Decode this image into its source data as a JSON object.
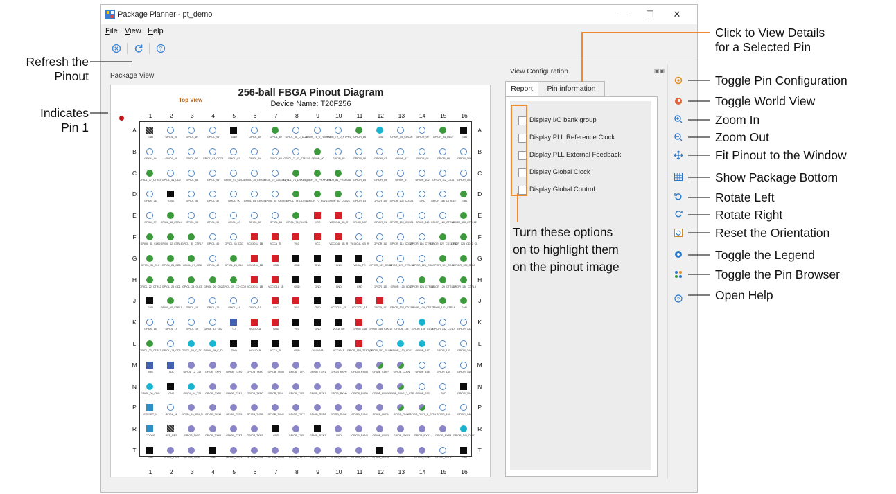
{
  "window": {
    "title": "Package Planner - pt_demo",
    "controls": [
      "—",
      "☐",
      "✕"
    ]
  },
  "menu": [
    {
      "key": "F",
      "rest": "ile"
    },
    {
      "key": "V",
      "rest": "iew"
    },
    {
      "key": "H",
      "rest": "elp"
    }
  ],
  "package_view": {
    "label": "Package View",
    "title": "256-ball FBGA Pinout Diagram",
    "device": "Device Name: T20F256",
    "top_view": "Top View"
  },
  "pinout": {
    "columns": [
      "1",
      "2",
      "3",
      "4",
      "5",
      "6",
      "7",
      "8",
      "9",
      "10",
      "11",
      "12",
      "13",
      "14",
      "15",
      "16"
    ],
    "rows": [
      "A",
      "B",
      "C",
      "D",
      "E",
      "F",
      "G",
      "H",
      "J",
      "K",
      "L",
      "M",
      "N",
      "P",
      "R",
      "T"
    ],
    "legend_colors": {
      "o": "#4a84c4",
      "g": "#3c9a3c",
      "k": "#0d0d0d",
      "r": "#d62027",
      "c": "#19b5d0",
      "p": "#8a85c7",
      "b": "#4361b0",
      "s": "#2e8fc7",
      "x": "#555555",
      "m": "#7ba05b"
    },
    "codes": [
      "xoooko gooogcoogk",
      "oooooooogoooooooo",
      "goooooogggoooooog",
      "okooooogggooooogk",
      "ogooooogrrooooogg",
      "gggoorrrrrooooggg",
      "gggogrrkkkkoooggg",
      "gggggrrkkkkoogggg",
      "kgoooorrkkrrooggk",
      "oooobrrkkkroocooo",
      "gocckkkkkkroccoo",
      "bbpppppppppmmooo",
      "ckcpppppppppmook",
      "soppppppppppmmoo",
      "sxppppkpkppppppc",
      "kppkpppppppkppok"
    ],
    "names": [
      [
        "GND",
        "GPIOL_90",
        "GPIOL_87",
        "GPIOL_96",
        "GND",
        "GPIOL_69",
        "GPIOL_62",
        "GPIOL_66_C_DC12",
        "GPIOR_78_D_RTPRD_CD13",
        "GPIOR_79_D_RTPRD_CD13_0",
        "GPIOR_86",
        "GND",
        "GPIOR_89_CDC26",
        "GPIOR_99",
        "GPIOR_94_DD27",
        "GND"
      ],
      [
        "GPIOL_44",
        "GPIOL_48",
        "GPIOL_92",
        "GPIOL_93_CDC5",
        "GPIOL_63",
        "GPIOL_64",
        "GPIOL_60",
        "GPIOL_71_G_STATUS",
        "GPIOR_80",
        "GPIOR_82",
        "GPIOR_88",
        "GPIOR_93",
        "GPIOR_97",
        "GPIOR_92",
        "GPIOR_98",
        "GPIOR_106"
      ],
      [
        "GPIOL_37_CTRL5",
        "GPIOL_41_CD3",
        "GPIOL_68",
        "GPIOL_95",
        "GPIOL_67_CDC3",
        "GPIOL_70_CRXEG",
        "GPIOL_72_CRXEG_CD23",
        "GPIOL_73_DRXEG_CD23",
        "GPIOR_76_PRXPD18",
        "GPIOR_81_PRXPD18",
        "GPIOR_85",
        "GPIOR_89",
        "GPIOR_91",
        "GPIOR_102",
        "GPIOR_112_CD21",
        "GPIOR_103"
      ],
      [
        "GPIOL_36",
        "GND",
        "GPIOL_46",
        "GPIOL_47",
        "GPIOL_90",
        "GPIOL_65_CRXEG",
        "GPIOL_65_CRXEG",
        "GPIOL_74_DLVS1",
        "GPIOR_77_PLVS1",
        "GPIOR_87_CCD21",
        "GPIOR_83",
        "GPIOR_100",
        "GPIOR_104_CD126",
        "GND",
        "GPIOR_116_CTRL19",
        "GND"
      ],
      [
        "GPIOL_37",
        "GPIOL_38_CTRL4",
        "GPIOL_95",
        "GPIOL_99",
        "GPIOL_40",
        "GPIOL_89",
        "GPIOL_88",
        "GPIOL_75_PLVS1",
        "VCC",
        "VCCIO4L_0B_R",
        "GPIOR_107",
        "GPIOR_51",
        "GPIOR_109_CD124",
        "GPIOR_110",
        "GPIOR_120_CTRL19",
        "GPIOR_115_CTRL12"
      ],
      [
        "GPIOL_30_CLK0",
        "GPIOL_32_CTRL6",
        "GPIOL_35_CTRL7",
        "GPIOL_40",
        "GPIOL_46_CD3",
        "VCCIO1L_1B",
        "VCCA_TL",
        "VCC",
        "VCC",
        "VCCIO4L_0B_R",
        "VCCIO4L_0B_R",
        "GPIOR_111",
        "GPIOR_113_CD122",
        "GPIOR_116_CTRL13",
        "GPIOR_122_CD11_CD12",
        "GPIOR_125_CD12_CD12"
      ],
      [
        "GPIOL_31_CLK",
        "GPIOL_25_CD8",
        "GPIOL_27_CD8",
        "GPIOL_42",
        "GPIOL_26_CLK",
        "VCCIO1L_1B",
        "GND",
        "GND",
        "GND",
        "GND",
        "VCCA_TR",
        "GPIOR_121_CD14",
        "GPIOR_127_CTRL14",
        "GPIOR_126_CD8",
        "GPIOR_124_CD11",
        "GPIOR_128_CLK8"
      ],
      [
        "GPIOL_22_CTRL2",
        "GPIOL_25_CD1",
        "GPIOL_24_CLK5",
        "GPIOL_26_CD2",
        "GPIOL_29_CD_CD9",
        "VCCIO1L_1B",
        "VCCIO1L_1B",
        "GND",
        "GND",
        "GND",
        "GND",
        "GPIOR_130",
        "GPIOR_125_CD13",
        "GPIOR_126_CTRL11",
        "GPIOR_129_CTRL10",
        "GPIOR_130_CTRL9"
      ],
      [
        "GND",
        "GPIOL_20_CTRL1",
        "GPIOL_15",
        "GPIOL_16",
        "GPIOL_14",
        "GPIOL_11",
        "VCC",
        "VCC",
        "GND",
        "VCCIO1L_1B",
        "VCCIO1L_1B",
        "GPIOR_141",
        "GPIOR_133_CD110",
        "GPIOR_135_CD117",
        "GPIOR_131_CTRL8",
        "GND"
      ],
      [
        "GPIOL_18",
        "GPIOL_19",
        "GPIOL_19",
        "GPIOL_13_CD2",
        "TDI",
        "VCCIO1A",
        "GND",
        "VCC",
        "GND",
        "VCCA_BR",
        "GPIOR_148",
        "GPIOR_136_CDC10",
        "GPIOR_138",
        "GPIOR_136_CD19",
        "GPIOR_132_CD10",
        "GPIOR_133"
      ],
      [
        "GPIOL_23_CTRL3",
        "GPIOL_13_CD3",
        "GPIOL_08_C_DI3",
        "GPIOL_09_C_DI",
        "TDO",
        "VCCIO1B",
        "VCCA_BL",
        "GND",
        "VCCIO4A",
        "VCCIO4A",
        "GPIOR_158_TEST_N",
        "GPIOR_157_PLLIN",
        "GPIOR_150_CD01",
        "GPIOR_147",
        "GPIOR_143",
        "GPIOR_144"
      ],
      [
        "TMS",
        "TCK",
        "GPIOL_12_CDI",
        "GPIOB_TXP0",
        "GPIOB_TXN0",
        "GPIOB_TXP0",
        "GPIOB_TXN0",
        "GPIOB_TXP1",
        "GPIOB_TXN1",
        "GPIOB_RXP0",
        "GPIOB_RXN0",
        "GPIOB_CLKP",
        "GPIOB_CLKN",
        "GPIOR_156",
        "GPIOR_144",
        "GPIOR_145"
      ],
      [
        "GPIOL_09_CDI1",
        "GND",
        "GPIOL_04_CDI",
        "GPIOB_TXP0",
        "GPIOB_TXN1",
        "GPIOB_TXP0",
        "GPIOB_TXN1",
        "GPIOB_TXP1",
        "GPIOB_RXN1",
        "GPIOB_RXN0",
        "GPIOB_RXP0",
        "GPIOB_RXN1",
        "GPIOB_RXN1_2_CTRL",
        "GPIOR_153",
        "GND",
        "GPIOR_154"
      ],
      [
        "CRESET_N",
        "GPIOL_02",
        "GPIOL_03_CDI_N",
        "GPIOB_TXN3",
        "GPIOB_TXN3",
        "GPIOB_TXN3",
        "GPIOB_TXN2",
        "GPIOB_TXP2",
        "GPIOB_RXP2",
        "GPIOB_RXN2",
        "GPIOB_RXN2",
        "GPIOB_RXP1",
        "GPIOB_RXN2",
        "GPIOB_RXP1_2_CTRL",
        "GPIOR_150",
        "GPIOR_146"
      ],
      [
        "CDONE",
        "REF_RES",
        "GPIOB_TXP3",
        "GPIOB_TXN3",
        "GPIOB_TXN3",
        "GPIOB_TXP3",
        "GND",
        "GPIOB_TXP1",
        "GPIOB_RXN3",
        "GND",
        "GPIOB_RXN3",
        "GPIOB_RXP3",
        "GPIOB_RXP3",
        "GPIOB_RXN3",
        "GPIOB_RXP4",
        "GPIOR_149_CDI12"
      ],
      [
        "GND",
        "GPIOB_TXP4",
        "GPIOB_TXN4",
        "GND",
        "GPIOB_TXN4",
        "GPIOB_TXN4",
        "GPIOB_TXN4",
        "GPIOB_TXP1",
        "GPIOB_RXP3",
        "GPIOB_RXN3",
        "GPIOB_RXP4",
        "GPIOB_RXN4",
        "GND",
        "GPIOB_RXN4",
        "GPIOB_RXP4",
        "GND"
      ]
    ]
  },
  "view_config": {
    "label": "View Configuration",
    "tabs": [
      "Report",
      "Pin information"
    ],
    "options": [
      "Display I/O bank group",
      "Display PLL Reference Clock",
      "Display PLL External Feedback",
      "Display Global Clock",
      "Display Global Control"
    ]
  },
  "annotations": {
    "refresh": "Refresh the\nPinout",
    "pin1": "Indicates\nPin 1",
    "details": "Click to View Details\nfor a Selected Pin",
    "options": "Turn these options\non to highlight them\non the pinout image",
    "sidebar": [
      "Toggle Pin Configuration",
      "Toggle World View",
      "Zoom In",
      "Zoom Out",
      "Fit Pinout to the Window",
      "Show Package Bottom",
      "Rotate Left",
      "Rotate Right",
      "Reset the Orientation",
      "Toggle the Legend",
      "Toggle the Pin Browser",
      "Open Help"
    ]
  }
}
